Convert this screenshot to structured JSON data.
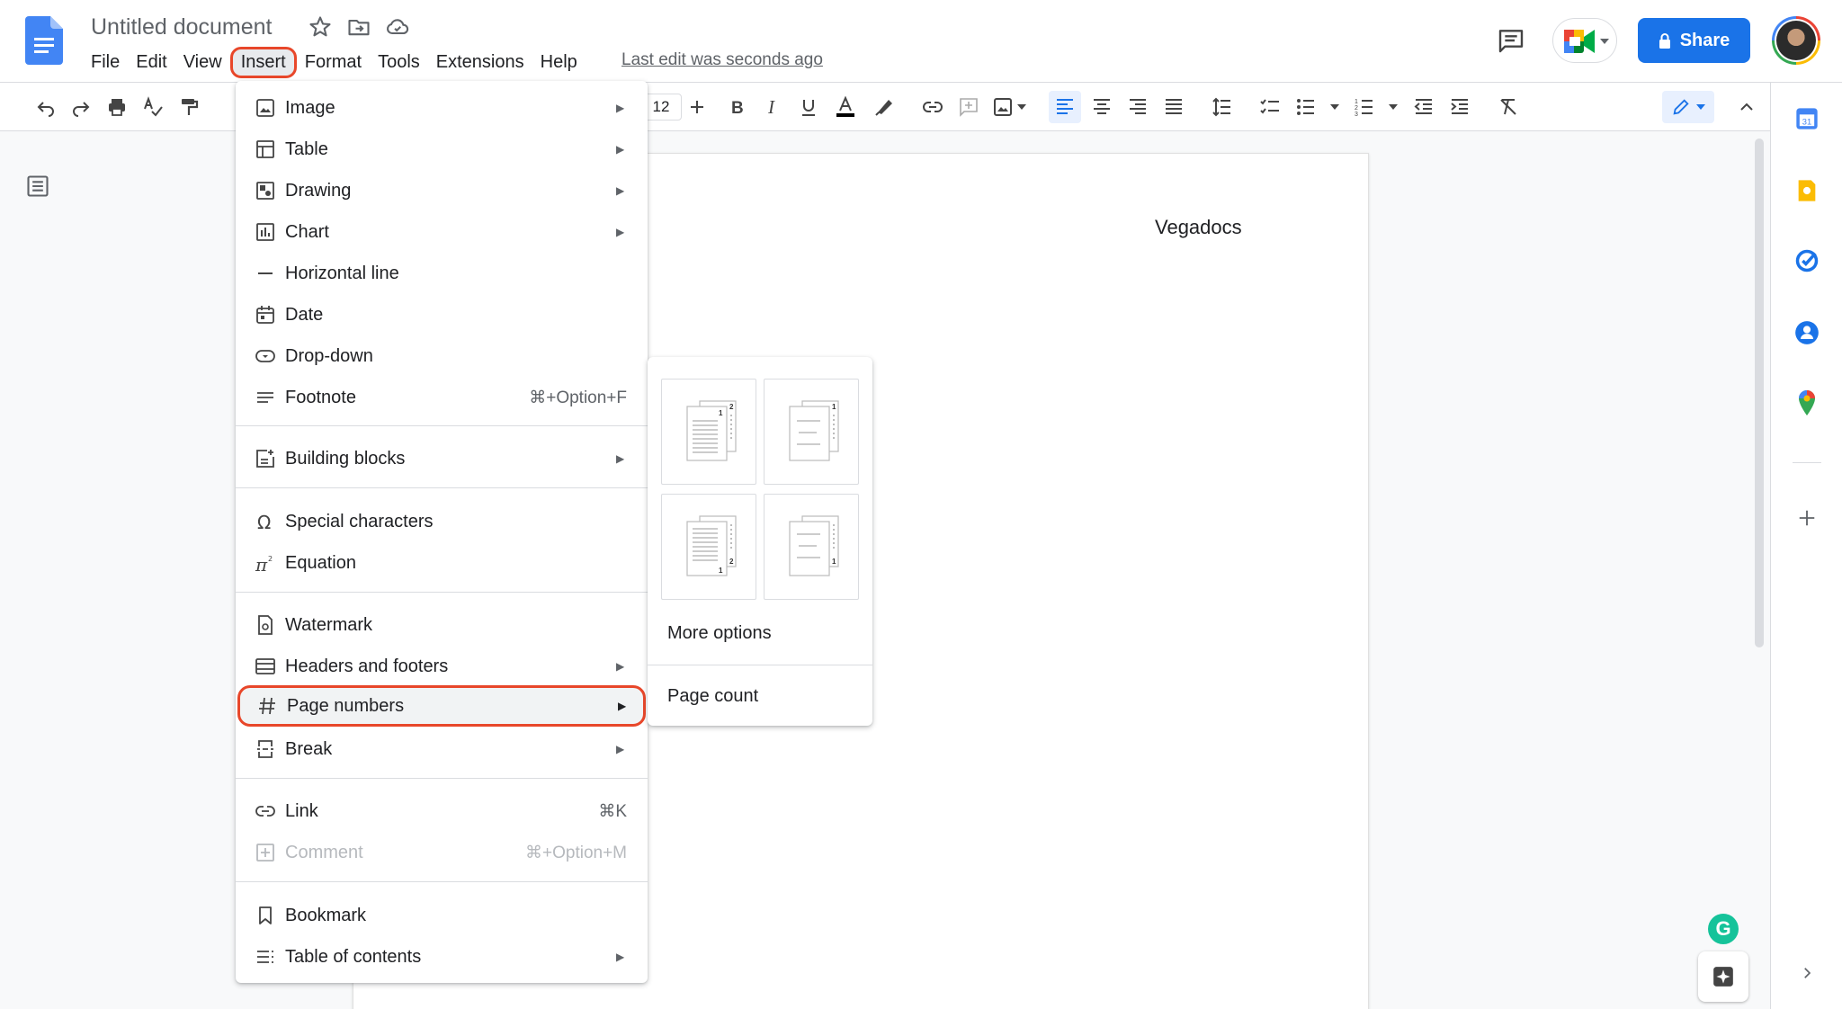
{
  "window": {
    "doc_title": "Untitled document",
    "last_edit": "Last edit was seconds ago",
    "share_label": "Share"
  },
  "menubar": [
    "File",
    "Edit",
    "View",
    "Insert",
    "Format",
    "Tools",
    "Extensions",
    "Help"
  ],
  "toolbar": {
    "font_size": "12"
  },
  "document": {
    "header_text": "Vegadocs"
  },
  "insert_menu": {
    "items": [
      {
        "label": "Image",
        "icon": "image-icon",
        "submenu": true
      },
      {
        "label": "Table",
        "icon": "table-icon",
        "submenu": true
      },
      {
        "label": "Drawing",
        "icon": "drawing-icon",
        "submenu": true
      },
      {
        "label": "Chart",
        "icon": "chart-icon",
        "submenu": true
      },
      {
        "label": "Horizontal line",
        "icon": "horizontal-line-icon",
        "submenu": false
      },
      {
        "label": "Date",
        "icon": "calendar-icon",
        "submenu": false
      },
      {
        "label": "Drop-down",
        "icon": "dropdown-icon",
        "submenu": false
      },
      {
        "label": "Footnote",
        "icon": "footnote-icon",
        "shortcut": "⌘+Option+F"
      },
      {
        "label": "Building blocks",
        "icon": "building-blocks-icon",
        "submenu": true
      },
      {
        "label": "Special characters",
        "icon": "omega-icon",
        "submenu": false
      },
      {
        "label": "Equation",
        "icon": "pi-icon",
        "submenu": false
      },
      {
        "label": "Watermark",
        "icon": "watermark-icon",
        "submenu": false
      },
      {
        "label": "Headers and footers",
        "icon": "header-footer-icon",
        "submenu": true
      },
      {
        "label": "Page numbers",
        "icon": "hash-icon",
        "submenu": true,
        "highlighted": true
      },
      {
        "label": "Break",
        "icon": "break-icon",
        "submenu": true
      },
      {
        "label": "Link",
        "icon": "link-icon",
        "shortcut": "⌘K"
      },
      {
        "label": "Comment",
        "icon": "comment-add-icon",
        "shortcut": "⌘+Option+M",
        "disabled": true
      },
      {
        "label": "Bookmark",
        "icon": "bookmark-icon",
        "submenu": false
      },
      {
        "label": "Table of contents",
        "icon": "toc-icon",
        "submenu": true
      }
    ]
  },
  "page_numbers_submenu": {
    "options": [
      {
        "name": "header-all-pages",
        "page_numbers": [
          "1",
          "2"
        ]
      },
      {
        "name": "header-skip-first",
        "page_numbers": [
          "1"
        ]
      },
      {
        "name": "footer-all-pages",
        "page_numbers": [
          "1",
          "2"
        ]
      },
      {
        "name": "footer-skip-first",
        "page_numbers": [
          "1"
        ]
      }
    ],
    "more_options": "More options",
    "page_count": "Page count"
  },
  "colors": {
    "accent": "#1a73e8",
    "highlight_outline": "#e8472a"
  }
}
